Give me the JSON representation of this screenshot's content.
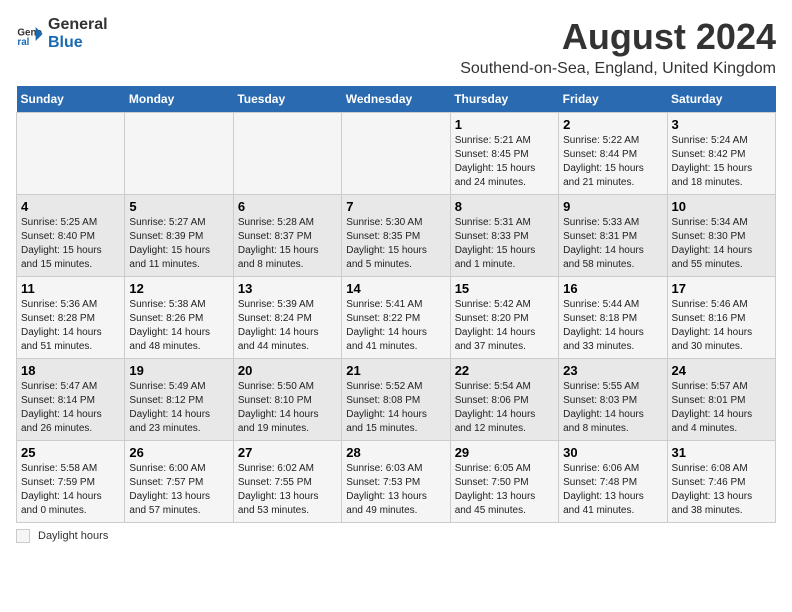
{
  "logo": {
    "general": "General",
    "blue": "Blue"
  },
  "title": "August 2024",
  "subtitle": "Southend-on-Sea, England, United Kingdom",
  "days_of_week": [
    "Sunday",
    "Monday",
    "Tuesday",
    "Wednesday",
    "Thursday",
    "Friday",
    "Saturday"
  ],
  "footer": {
    "daylight_label": "Daylight hours"
  },
  "weeks": [
    [
      {
        "day": "",
        "sunrise": "",
        "sunset": "",
        "daylight": ""
      },
      {
        "day": "",
        "sunrise": "",
        "sunset": "",
        "daylight": ""
      },
      {
        "day": "",
        "sunrise": "",
        "sunset": "",
        "daylight": ""
      },
      {
        "day": "",
        "sunrise": "",
        "sunset": "",
        "daylight": ""
      },
      {
        "day": "1",
        "sunrise": "Sunrise: 5:21 AM",
        "sunset": "Sunset: 8:45 PM",
        "daylight": "Daylight: 15 hours and 24 minutes."
      },
      {
        "day": "2",
        "sunrise": "Sunrise: 5:22 AM",
        "sunset": "Sunset: 8:44 PM",
        "daylight": "Daylight: 15 hours and 21 minutes."
      },
      {
        "day": "3",
        "sunrise": "Sunrise: 5:24 AM",
        "sunset": "Sunset: 8:42 PM",
        "daylight": "Daylight: 15 hours and 18 minutes."
      }
    ],
    [
      {
        "day": "4",
        "sunrise": "Sunrise: 5:25 AM",
        "sunset": "Sunset: 8:40 PM",
        "daylight": "Daylight: 15 hours and 15 minutes."
      },
      {
        "day": "5",
        "sunrise": "Sunrise: 5:27 AM",
        "sunset": "Sunset: 8:39 PM",
        "daylight": "Daylight: 15 hours and 11 minutes."
      },
      {
        "day": "6",
        "sunrise": "Sunrise: 5:28 AM",
        "sunset": "Sunset: 8:37 PM",
        "daylight": "Daylight: 15 hours and 8 minutes."
      },
      {
        "day": "7",
        "sunrise": "Sunrise: 5:30 AM",
        "sunset": "Sunset: 8:35 PM",
        "daylight": "Daylight: 15 hours and 5 minutes."
      },
      {
        "day": "8",
        "sunrise": "Sunrise: 5:31 AM",
        "sunset": "Sunset: 8:33 PM",
        "daylight": "Daylight: 15 hours and 1 minute."
      },
      {
        "day": "9",
        "sunrise": "Sunrise: 5:33 AM",
        "sunset": "Sunset: 8:31 PM",
        "daylight": "Daylight: 14 hours and 58 minutes."
      },
      {
        "day": "10",
        "sunrise": "Sunrise: 5:34 AM",
        "sunset": "Sunset: 8:30 PM",
        "daylight": "Daylight: 14 hours and 55 minutes."
      }
    ],
    [
      {
        "day": "11",
        "sunrise": "Sunrise: 5:36 AM",
        "sunset": "Sunset: 8:28 PM",
        "daylight": "Daylight: 14 hours and 51 minutes."
      },
      {
        "day": "12",
        "sunrise": "Sunrise: 5:38 AM",
        "sunset": "Sunset: 8:26 PM",
        "daylight": "Daylight: 14 hours and 48 minutes."
      },
      {
        "day": "13",
        "sunrise": "Sunrise: 5:39 AM",
        "sunset": "Sunset: 8:24 PM",
        "daylight": "Daylight: 14 hours and 44 minutes."
      },
      {
        "day": "14",
        "sunrise": "Sunrise: 5:41 AM",
        "sunset": "Sunset: 8:22 PM",
        "daylight": "Daylight: 14 hours and 41 minutes."
      },
      {
        "day": "15",
        "sunrise": "Sunrise: 5:42 AM",
        "sunset": "Sunset: 8:20 PM",
        "daylight": "Daylight: 14 hours and 37 minutes."
      },
      {
        "day": "16",
        "sunrise": "Sunrise: 5:44 AM",
        "sunset": "Sunset: 8:18 PM",
        "daylight": "Daylight: 14 hours and 33 minutes."
      },
      {
        "day": "17",
        "sunrise": "Sunrise: 5:46 AM",
        "sunset": "Sunset: 8:16 PM",
        "daylight": "Daylight: 14 hours and 30 minutes."
      }
    ],
    [
      {
        "day": "18",
        "sunrise": "Sunrise: 5:47 AM",
        "sunset": "Sunset: 8:14 PM",
        "daylight": "Daylight: 14 hours and 26 minutes."
      },
      {
        "day": "19",
        "sunrise": "Sunrise: 5:49 AM",
        "sunset": "Sunset: 8:12 PM",
        "daylight": "Daylight: 14 hours and 23 minutes."
      },
      {
        "day": "20",
        "sunrise": "Sunrise: 5:50 AM",
        "sunset": "Sunset: 8:10 PM",
        "daylight": "Daylight: 14 hours and 19 minutes."
      },
      {
        "day": "21",
        "sunrise": "Sunrise: 5:52 AM",
        "sunset": "Sunset: 8:08 PM",
        "daylight": "Daylight: 14 hours and 15 minutes."
      },
      {
        "day": "22",
        "sunrise": "Sunrise: 5:54 AM",
        "sunset": "Sunset: 8:06 PM",
        "daylight": "Daylight: 14 hours and 12 minutes."
      },
      {
        "day": "23",
        "sunrise": "Sunrise: 5:55 AM",
        "sunset": "Sunset: 8:03 PM",
        "daylight": "Daylight: 14 hours and 8 minutes."
      },
      {
        "day": "24",
        "sunrise": "Sunrise: 5:57 AM",
        "sunset": "Sunset: 8:01 PM",
        "daylight": "Daylight: 14 hours and 4 minutes."
      }
    ],
    [
      {
        "day": "25",
        "sunrise": "Sunrise: 5:58 AM",
        "sunset": "Sunset: 7:59 PM",
        "daylight": "Daylight: 14 hours and 0 minutes."
      },
      {
        "day": "26",
        "sunrise": "Sunrise: 6:00 AM",
        "sunset": "Sunset: 7:57 PM",
        "daylight": "Daylight: 13 hours and 57 minutes."
      },
      {
        "day": "27",
        "sunrise": "Sunrise: 6:02 AM",
        "sunset": "Sunset: 7:55 PM",
        "daylight": "Daylight: 13 hours and 53 minutes."
      },
      {
        "day": "28",
        "sunrise": "Sunrise: 6:03 AM",
        "sunset": "Sunset: 7:53 PM",
        "daylight": "Daylight: 13 hours and 49 minutes."
      },
      {
        "day": "29",
        "sunrise": "Sunrise: 6:05 AM",
        "sunset": "Sunset: 7:50 PM",
        "daylight": "Daylight: 13 hours and 45 minutes."
      },
      {
        "day": "30",
        "sunrise": "Sunrise: 6:06 AM",
        "sunset": "Sunset: 7:48 PM",
        "daylight": "Daylight: 13 hours and 41 minutes."
      },
      {
        "day": "31",
        "sunrise": "Sunrise: 6:08 AM",
        "sunset": "Sunset: 7:46 PM",
        "daylight": "Daylight: 13 hours and 38 minutes."
      }
    ]
  ]
}
